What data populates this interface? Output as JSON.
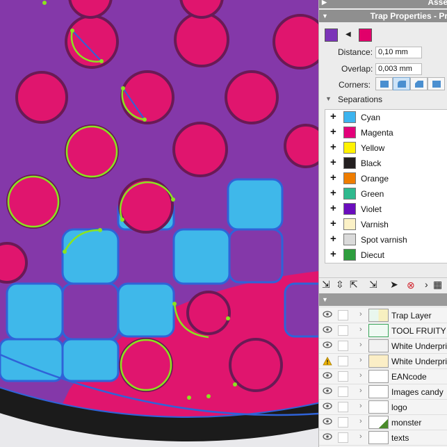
{
  "panel": {
    "assets_header": "Asse",
    "trap_header": "Trap Properties - Pr",
    "colors": {
      "fill_a": "#7b34b8",
      "fill_b": "#e1006a",
      "purple_bg": "#8438a9",
      "magenta": "#e0156e",
      "cyan": "#3fb8ea",
      "dark_edge": "#6a1a55",
      "trap_line": "#2f63d8",
      "green_line": "#8be41e"
    },
    "distance_label": "Distance:",
    "distance_value": "0,10 mm",
    "overlap_label": "Overlap:",
    "overlap_value": "0,003 mm",
    "corners_label": "Corners:",
    "separations_label": "Separations",
    "separations": [
      {
        "name": "Cyan",
        "color": "#3db4ef"
      },
      {
        "name": "Magenta",
        "color": "#e3007a"
      },
      {
        "name": "Yellow",
        "color": "#fff200"
      },
      {
        "name": "Black",
        "color": "#231f20"
      },
      {
        "name": "Orange",
        "color": "#ef7d00"
      },
      {
        "name": "Green",
        "color": "#2fb98e"
      },
      {
        "name": "Violet",
        "color": "#6a0dbd"
      },
      {
        "name": "Varnish",
        "color": "#fbf1c6"
      },
      {
        "name": "Spot varnish",
        "color": "#dadada"
      },
      {
        "name": "Diecut",
        "color": "#2e9e3e"
      }
    ],
    "layers": [
      {
        "name": "Trap Layer",
        "icon": "eye-icon"
      },
      {
        "name": "TOOL FRUITY B",
        "icon": "eye-icon"
      },
      {
        "name": "White Underpri",
        "icon": "eye-icon"
      },
      {
        "name": "White Underpri",
        "icon": "warning-icon"
      },
      {
        "name": "EANcode",
        "icon": "eye-icon"
      },
      {
        "name": "Images candy",
        "icon": "eye-icon"
      },
      {
        "name": "logo",
        "icon": "eye-icon"
      },
      {
        "name": "monster",
        "icon": "eye-icon"
      },
      {
        "name": "texts",
        "icon": "eye-icon"
      }
    ]
  }
}
